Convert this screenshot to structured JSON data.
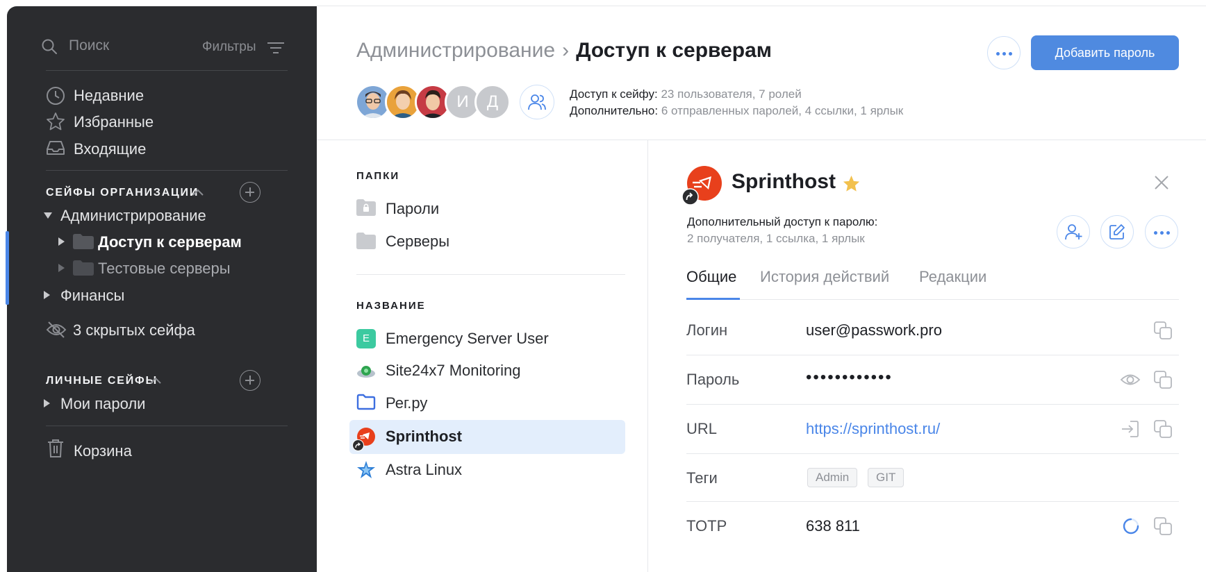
{
  "colors": {
    "sidebar_bg": "#2b2c2f",
    "accent": "#4a86e8",
    "primary_button": "#4f8ae0",
    "selected_row": "#e3eefc",
    "star": "#f2c14e",
    "sprinthost_red": "#e8401c"
  },
  "sidebar": {
    "search_placeholder": "Поиск",
    "filters_label": "Фильтры",
    "nav": [
      {
        "label": "Недавние",
        "icon": "clock-icon"
      },
      {
        "label": "Избранные",
        "icon": "star-icon"
      },
      {
        "label": "Входящие",
        "icon": "inbox-icon"
      }
    ],
    "org_section": "СЕЙФЫ ОРГАНИЗАЦИИ",
    "org_tree": {
      "admin": "Администрирование",
      "server_access": "Доступ к серверам",
      "test_servers": "Тестовые серверы",
      "finance": "Финансы"
    },
    "hidden_safes": "3 скрытых сейфа",
    "personal_section": "ЛИЧНЫЕ СЕЙФЫ",
    "my_passwords": "Мои пароли",
    "trash": "Корзина"
  },
  "header": {
    "breadcrumb_parent": "Администрирование",
    "breadcrumb_sep": "›",
    "breadcrumb_current": "Доступ к серверам",
    "add_button": "Добавить пароль",
    "avatars": [
      "photo-1",
      "photo-2",
      "photo-3",
      "И",
      "Д"
    ],
    "access_label": "Доступ к сейфу:",
    "access_value": "23 пользователя, 7 ролей",
    "extra_label": "Дополнительно:",
    "extra_value": "6 отправленных паролей, 4 ссылки, 1 ярлык"
  },
  "folders": {
    "section": "ПАПКИ",
    "items": [
      "Пароли",
      "Серверы"
    ]
  },
  "names": {
    "section": "НАЗВАНИЕ",
    "items": [
      {
        "label": "Emergency Server User",
        "icon": "letter-e-icon",
        "badge": "E"
      },
      {
        "label": "Site24x7 Monitoring",
        "icon": "site24x7-icon"
      },
      {
        "label": "Рег.ру",
        "icon": "folder-outline-icon"
      },
      {
        "label": "Sprinthost",
        "icon": "sprinthost-icon",
        "selected": true
      },
      {
        "label": "Astra Linux",
        "icon": "astra-star-icon"
      }
    ]
  },
  "detail": {
    "title": "Sprinthost",
    "extra_access_label": "Дополнительный доступ к паролю:",
    "extra_access_value": "2 получателя, 1 ссылка, 1 ярлык",
    "tabs": [
      "Общие",
      "История действий",
      "Редакции"
    ],
    "fields": {
      "login_label": "Логин",
      "login_value": "user@passwork.pro",
      "password_label": "Пароль",
      "password_value": "••••••••••••",
      "url_label": "URL",
      "url_value": "https://sprinthost.ru/",
      "tags_label": "Теги",
      "tags": [
        "Admin",
        "GIT"
      ],
      "totp_label": "TOTP",
      "totp_value": "638 811"
    }
  }
}
